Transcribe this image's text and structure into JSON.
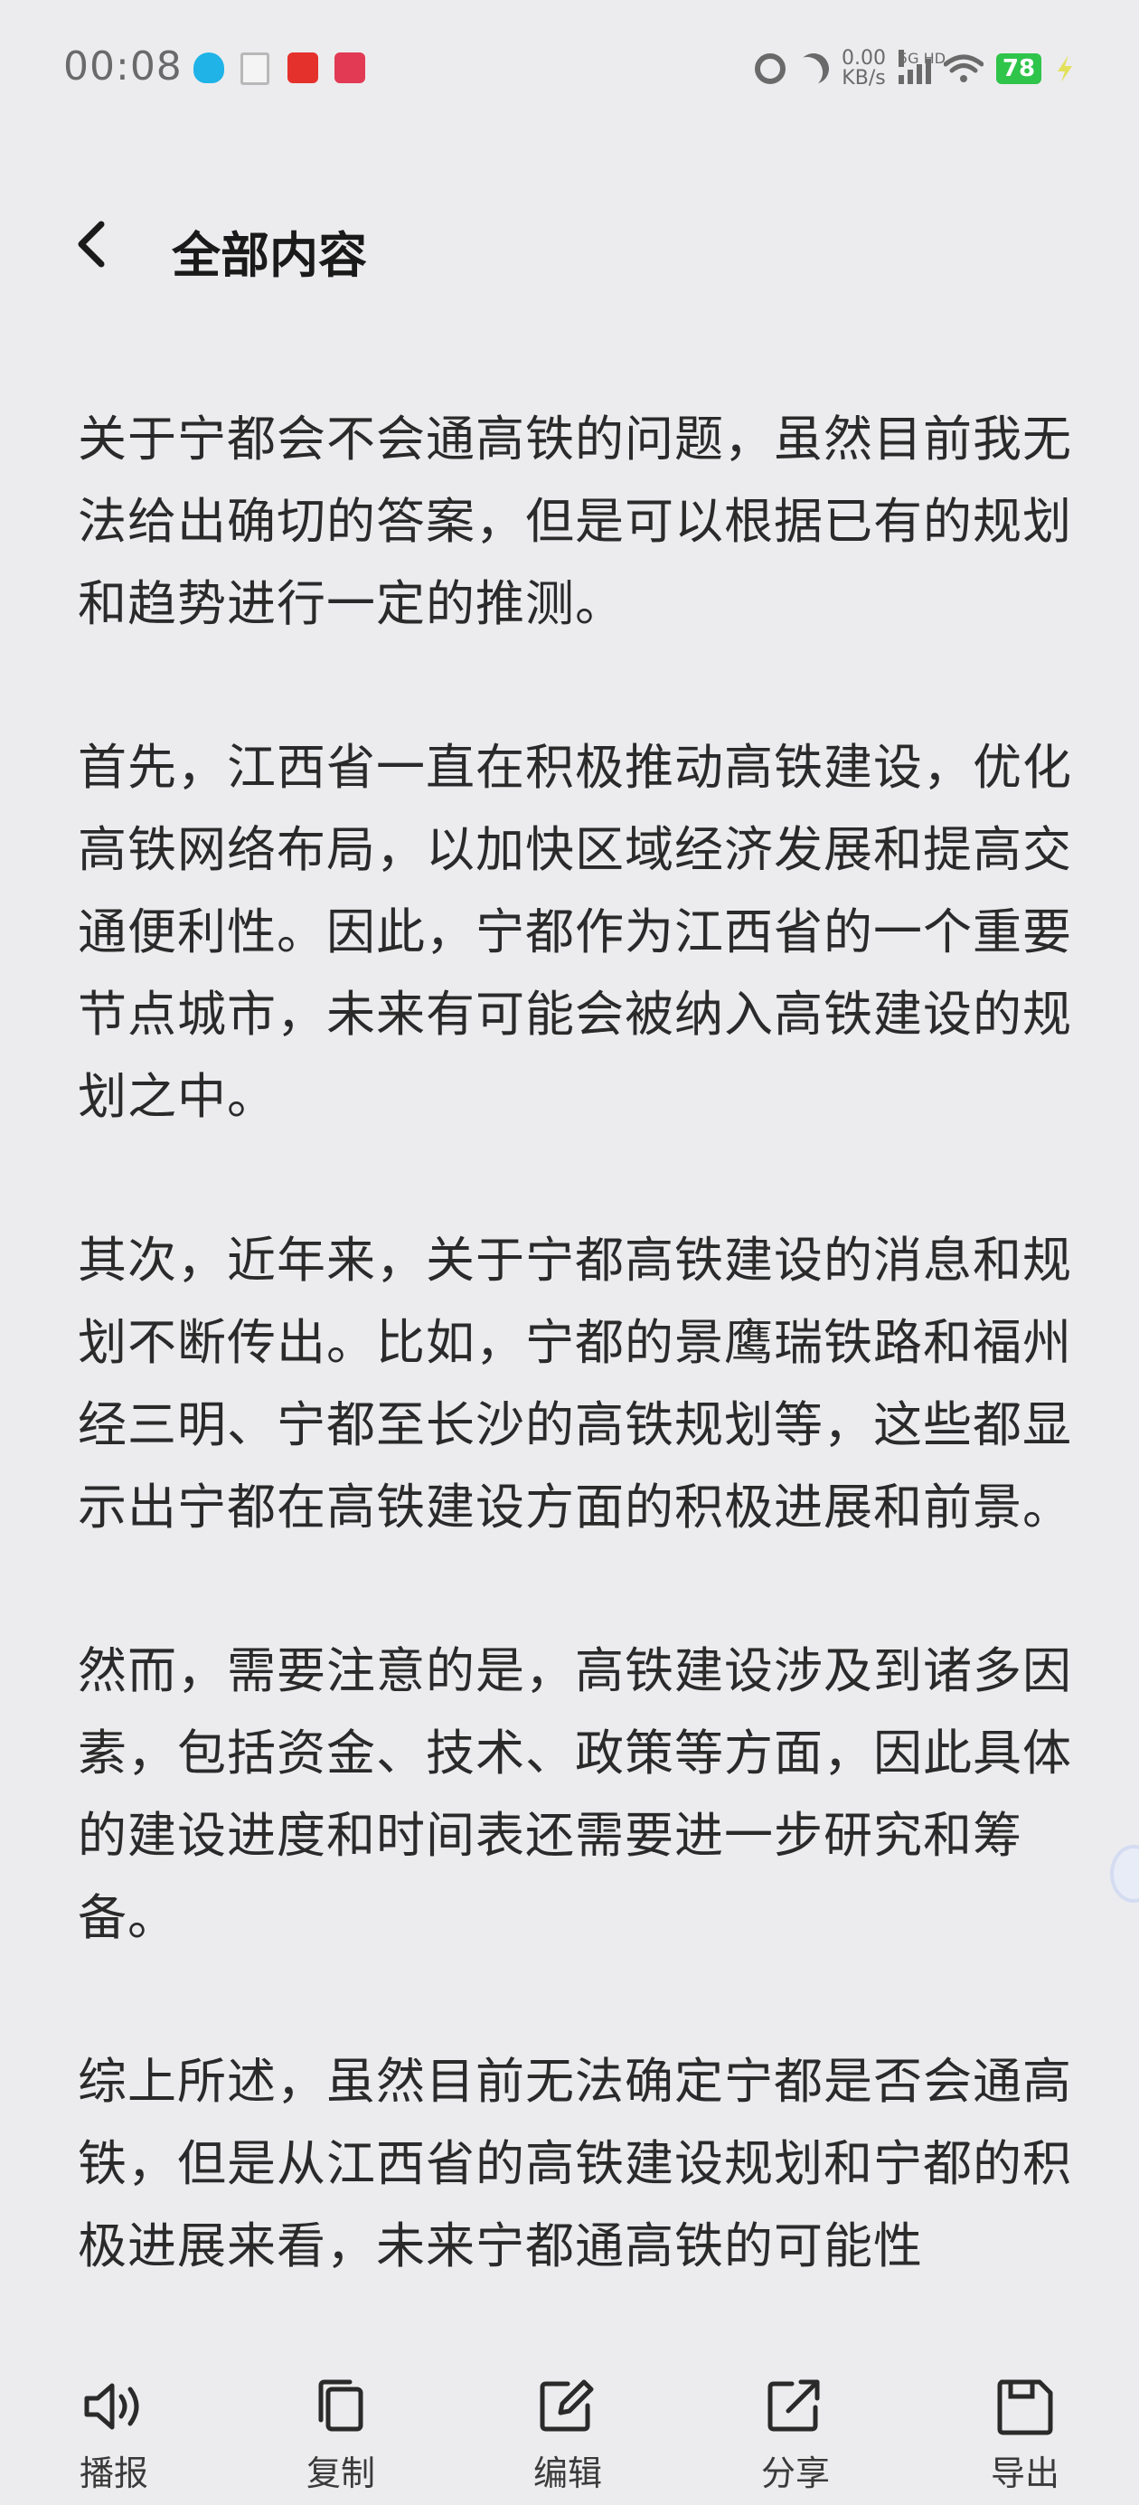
{
  "status_bar": {
    "time": "00:08",
    "net_speed_value": "0.00",
    "net_speed_unit": "KB/s",
    "network": "5G HD",
    "battery": "78"
  },
  "header": {
    "title": "全部内容"
  },
  "content": {
    "paragraphs": [
      "关于宁都会不会通高铁的问题，虽然目前我无法给出确切的答案，但是可以根据已有的规划和趋势进行一定的推测。",
      "首先，江西省一直在积极推动高铁建设，优化高铁网络布局，以加快区域经济发展和提高交通便利性。因此，宁都作为江西省的一个重要节点城市，未来有可能会被纳入高铁建设的规划之中。",
      "其次，近年来，关于宁都高铁建设的消息和规划不断传出。比如，宁都的景鹰瑞铁路和福州经三明、宁都至长沙的高铁规划等，这些都显示出宁都在高铁建设方面的积极进展和前景。",
      "然而，需要注意的是，高铁建设涉及到诸多因素，包括资金、技术、政策等方面，因此具体的建设进度和时间表还需要进一步研究和筹备。",
      "综上所述，虽然目前无法确定宁都是否会通高铁，但是从江西省的高铁建设规划和宁都的积极进展来看，未来宁都通高铁的可能性"
    ]
  },
  "toolbar": {
    "broadcast": "播报",
    "copy": "复制",
    "edit": "编辑",
    "share": "分享",
    "export": "导出"
  }
}
